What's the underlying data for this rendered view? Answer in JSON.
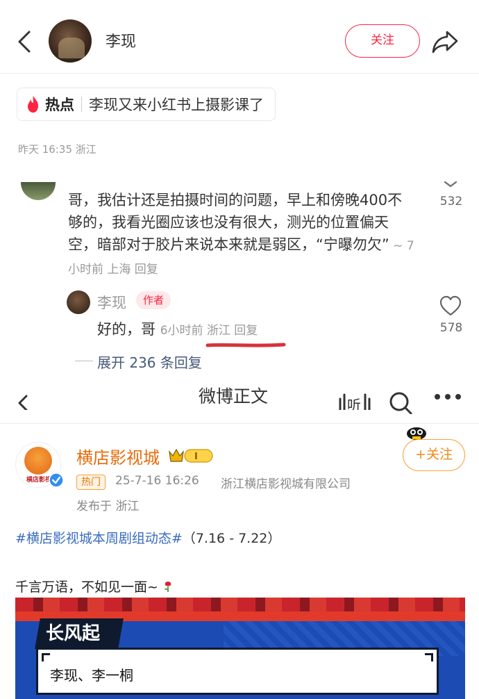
{
  "xhs": {
    "header": {
      "username": "李现",
      "follow_label": "关注"
    },
    "hot": {
      "label": "热点",
      "topic": "李现又来小红书上摄影课了"
    },
    "post_meta": "昨天 16:35  浙江",
    "comment": {
      "text": "哥，我估计还是拍摄时间的问题，早上和傍晚400不够的，我看光圈应该也没有很大，测光的位置偏天空，暗部对于胶片来说本来就是弱区，“宁曝勿欠”",
      "meta": " ~ 7小时前 上海  回复",
      "likes": "532"
    },
    "reply": {
      "name": "李现",
      "tag": "作者",
      "text": "好的，哥 ",
      "meta": "6小时前 浙江  回复",
      "likes": "578"
    },
    "expand_label": "展开 236 条回复"
  },
  "wb": {
    "nav": {
      "title": "微博正文"
    },
    "account": {
      "name": "横店影视城",
      "avatar_text": "横店影视",
      "follow_label": "+关注",
      "hot_tag": "热门",
      "time": "25-7-16 16:26",
      "source": "浙江横店影视城有限公司",
      "location": "发布于 浙江"
    },
    "post": {
      "topic": "#横店影视城本周剧组动态#",
      "date_range": "（7.16 - 7.22）",
      "body": "千言万语，不如见一面~"
    },
    "poster": {
      "tab": "长风起",
      "names": "李现、李一桐"
    }
  },
  "colors": {
    "xhs_red": "#ff2442",
    "weibo_orange": "#f08a1a",
    "topic_blue": "#3a6cbf",
    "poster_blue": "#1c4bb3"
  },
  "icons": [
    "back-icon",
    "share-icon",
    "fire-icon",
    "chevron-like-icon",
    "heart-icon",
    "listen-icon",
    "search-icon",
    "more-icon",
    "verified-icon",
    "vip-icon",
    "rose-icon"
  ]
}
